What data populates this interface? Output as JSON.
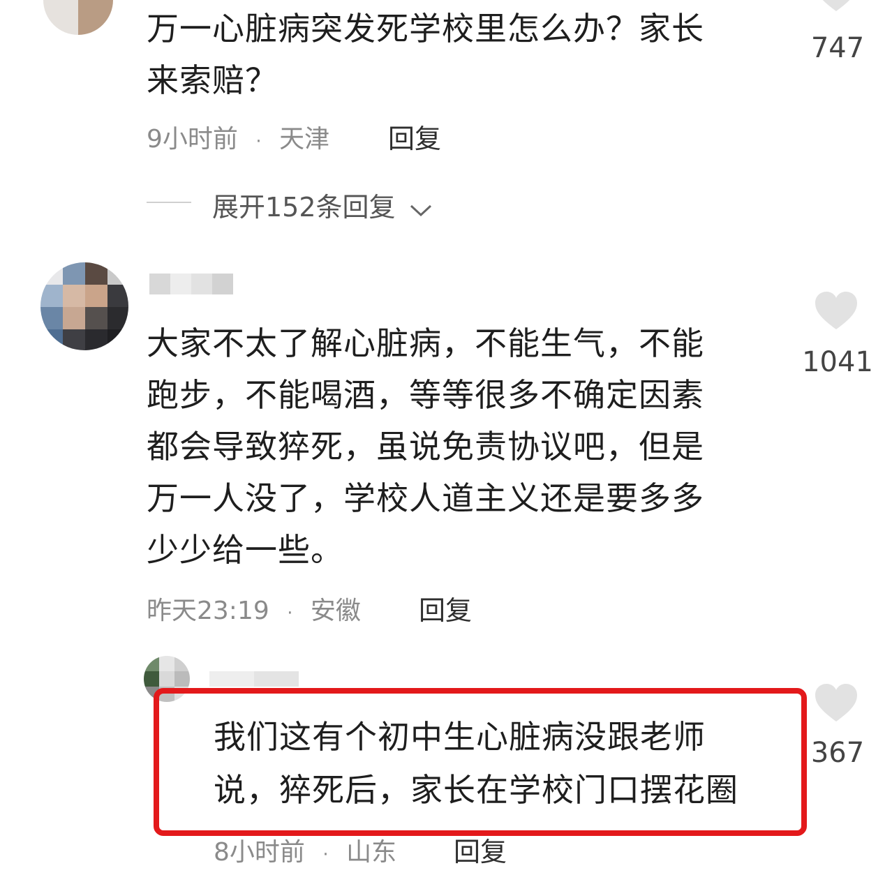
{
  "comments": [
    {
      "text_lines": [
        "万一心脏病突发死学校里怎么办？家长",
        "来索赔？"
      ],
      "time": "9小时前",
      "sep": "·",
      "location": "天津",
      "reply_label": "回复",
      "likes": "747",
      "expand_label": "展开152条回复"
    },
    {
      "text_lines": [
        "大家不太了解心脏病，不能生气，不能",
        "跑步，不能喝酒，等等很多不确定因素",
        "都会导致猝死，虽说免责协议吧，但是",
        "万一人没了，学校人道主义还是要多多",
        "少少给一些。"
      ],
      "time": "昨天23:19",
      "sep": "·",
      "location": "安徽",
      "reply_label": "回复",
      "likes": "1041"
    },
    {
      "text_lines": [
        "我们这有个初中生心脏病没跟老师",
        "说，猝死后，家长在学校门口摆花圈"
      ],
      "time": "8小时前",
      "sep": "·",
      "location": "山东",
      "reply_label": "回复",
      "likes": "367"
    }
  ],
  "icons": {
    "like": "heart-icon",
    "expand": "chevron-down-icon"
  },
  "colors": {
    "highlight": "#e3191b",
    "heart": "#e2e2e2"
  }
}
